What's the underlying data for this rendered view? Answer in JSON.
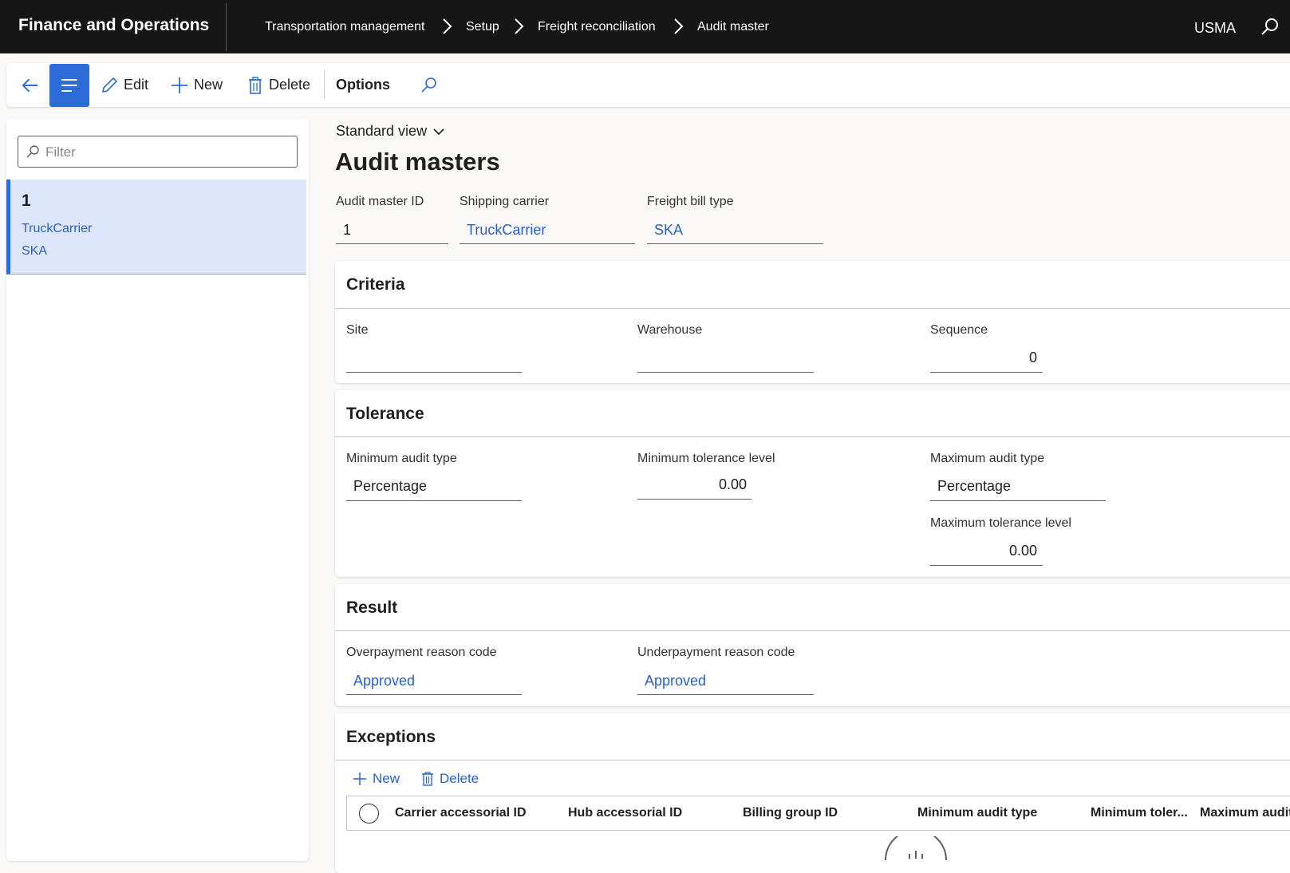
{
  "app": {
    "title": "Finance and Operations",
    "company": "USMA"
  },
  "breadcrumb": [
    "Transportation management",
    "Setup",
    "Freight reconciliation",
    "Audit master"
  ],
  "actions": {
    "edit": "Edit",
    "new": "New",
    "delete": "Delete",
    "options": "Options"
  },
  "list": {
    "filter_placeholder": "Filter",
    "items": [
      {
        "id": "1",
        "carrier": "TruckCarrier",
        "bill_type": "SKA"
      }
    ]
  },
  "view": {
    "name": "Standard view"
  },
  "page": {
    "title": "Audit masters"
  },
  "header": {
    "audit_master_id_label": "Audit master ID",
    "audit_master_id": "1",
    "shipping_carrier_label": "Shipping carrier",
    "shipping_carrier": "TruckCarrier",
    "freight_bill_type_label": "Freight bill type",
    "freight_bill_type": "SKA"
  },
  "criteria": {
    "title": "Criteria",
    "site_label": "Site",
    "site": "",
    "warehouse_label": "Warehouse",
    "warehouse": "",
    "sequence_label": "Sequence",
    "sequence": "0"
  },
  "tolerance": {
    "title": "Tolerance",
    "min_audit_type_label": "Minimum audit type",
    "min_audit_type": "Percentage",
    "min_tolerance_label": "Minimum tolerance level",
    "min_tolerance": "0.00",
    "max_audit_type_label": "Maximum audit type",
    "max_audit_type": "Percentage",
    "max_tolerance_label": "Maximum tolerance level",
    "max_tolerance": "0.00"
  },
  "result": {
    "title": "Result",
    "overpayment_label": "Overpayment reason code",
    "overpayment": "Approved",
    "underpayment_label": "Underpayment reason code",
    "underpayment": "Approved"
  },
  "exceptions": {
    "title": "Exceptions",
    "new": "New",
    "delete": "Delete",
    "columns": [
      "Carrier accessorial ID",
      "Hub accessorial ID",
      "Billing group ID",
      "Minimum audit type",
      "Minimum toler...",
      "Maximum audit"
    ]
  },
  "colors": {
    "accent": "#2b6cd8",
    "link": "#2b5fc7",
    "topbar": "#161616",
    "selected_row": "#dde6fb"
  }
}
